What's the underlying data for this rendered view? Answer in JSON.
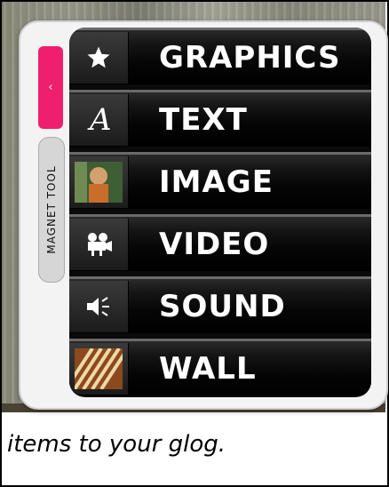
{
  "widget": {
    "side_tab_label": "MAGNET TOOL",
    "collapse_icon": "chevron-left-icon",
    "accent_color": "#ef1f6d"
  },
  "menu": {
    "items": [
      {
        "label": "GRAPHICS",
        "icon": "star-icon"
      },
      {
        "label": "TEXT",
        "icon": "text-icon"
      },
      {
        "label": "IMAGE",
        "icon": "image-icon"
      },
      {
        "label": "VIDEO",
        "icon": "video-camera-icon"
      },
      {
        "label": "SOUND",
        "icon": "speaker-icon"
      },
      {
        "label": "WALL",
        "icon": "wall-icon"
      }
    ]
  },
  "caption": "items to your glog."
}
